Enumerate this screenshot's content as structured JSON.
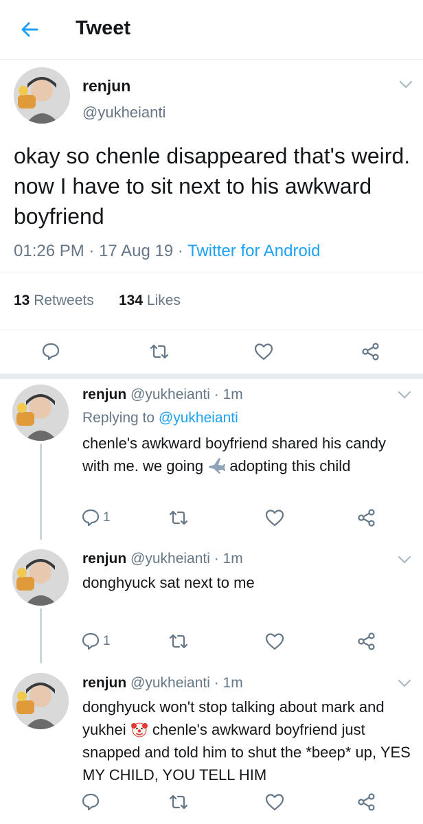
{
  "header": {
    "title": "Tweet"
  },
  "main_tweet": {
    "name": "renjun",
    "handle": "@yukheianti",
    "text": "okay so chenle disappeared that's weird. now I have to sit next to his awkward boyfriend",
    "time": "01:26 PM",
    "date": "17 Aug 19",
    "dot": "·",
    "source": "Twitter for Android",
    "retweets_count": "13",
    "retweets_label": "Retweets",
    "likes_count": "134",
    "likes_label": "Likes"
  },
  "replies": [
    {
      "name": "renjun",
      "handle_time": "@yukheianti · 1m",
      "replying_prefix": "Replying to",
      "replying_to": "@yukheianti",
      "text_before": "chenle's awkward boyfriend shared his candy with me. we going ",
      "emoji": "airplane",
      "text_after": " adopting this child",
      "reply_count": "1"
    },
    {
      "name": "renjun",
      "handle_time": "@yukheianti · 1m",
      "text": "donghyuck sat next to me",
      "reply_count": "1"
    },
    {
      "name": "renjun",
      "handle_time": "@yukheianti · 1m",
      "text_before": "donghyuck won't stop talking about mark and yukhei ",
      "emoji": "clown-face",
      "text_after": " chenle's awkward boyfriend just snapped and told him to shut the *beep* up, YES MY CHILD, YOU TELL HIM"
    }
  ],
  "colors": {
    "accent": "#1da1f2",
    "secondary_text": "#657786",
    "divider": "#e6ecf0"
  }
}
